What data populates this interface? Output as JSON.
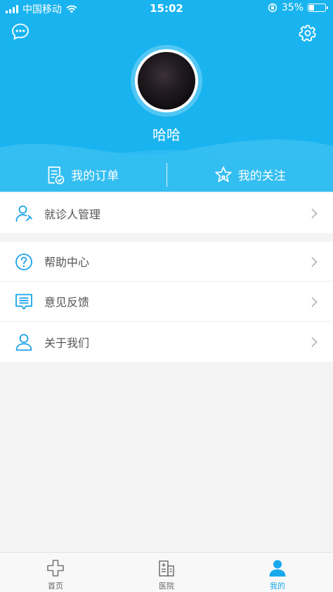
{
  "status_bar": {
    "carrier": "中国移动",
    "time": "15:02",
    "battery": "35%",
    "battery_level": 0.35
  },
  "profile": {
    "username": "哈哈"
  },
  "quick_actions": [
    {
      "label": "我的订单",
      "icon": "order-icon"
    },
    {
      "label": "我的关注",
      "icon": "star-icon"
    }
  ],
  "menu_group_1": [
    {
      "label": "就诊人管理",
      "icon": "patient-icon"
    }
  ],
  "menu_group_2": [
    {
      "label": "帮助中心",
      "icon": "help-icon"
    },
    {
      "label": "意见反馈",
      "icon": "feedback-icon"
    },
    {
      "label": "关于我们",
      "icon": "about-icon"
    }
  ],
  "tabbar": [
    {
      "label": "首页",
      "icon": "home-cross-icon",
      "active": false
    },
    {
      "label": "医院",
      "icon": "hospital-icon",
      "active": false
    },
    {
      "label": "我的",
      "icon": "user-icon",
      "active": true
    }
  ],
  "colors": {
    "primary": "#19b4f0",
    "tab_active": "#19a8ec",
    "icon_blue": "#1aa3e8",
    "text_gray": "#555555",
    "background": "#f4f4f4"
  }
}
